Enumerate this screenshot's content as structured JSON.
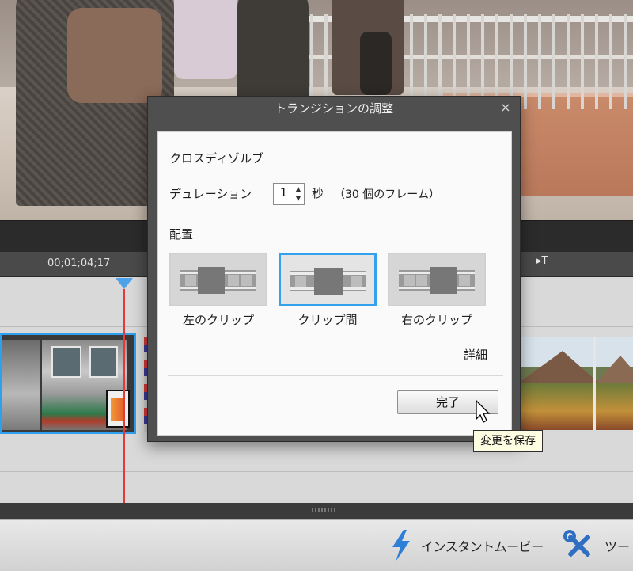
{
  "preview": {
    "scene": ""
  },
  "ruler": {
    "timecode": "00;01;04;17",
    "marker_icon": "▸T"
  },
  "dialog": {
    "title": "トランジションの調整",
    "close_icon": "×",
    "transition_name": "クロスディゾルブ",
    "duration_label": "デュレーション",
    "duration_value": "1",
    "seconds_unit": "秒",
    "frames_text": "（30 個のフレーム）",
    "placement_label": "配置",
    "placement_options": [
      {
        "label": "左のクリップ",
        "selected": false
      },
      {
        "label": "クリップ間",
        "selected": true
      },
      {
        "label": "右のクリップ",
        "selected": false
      }
    ],
    "details_link": "詳細",
    "done_button": "完了"
  },
  "tooltip": {
    "text": "変更を保存"
  },
  "bottom_bar": {
    "instant_movie": {
      "label": "インスタントムービー",
      "icon": "lightning-bolt-icon"
    },
    "tools": {
      "label": "ツー",
      "icon": "tools-icon"
    }
  },
  "colors": {
    "accent": "#34a1ec",
    "playhead": "#e43a3a"
  }
}
